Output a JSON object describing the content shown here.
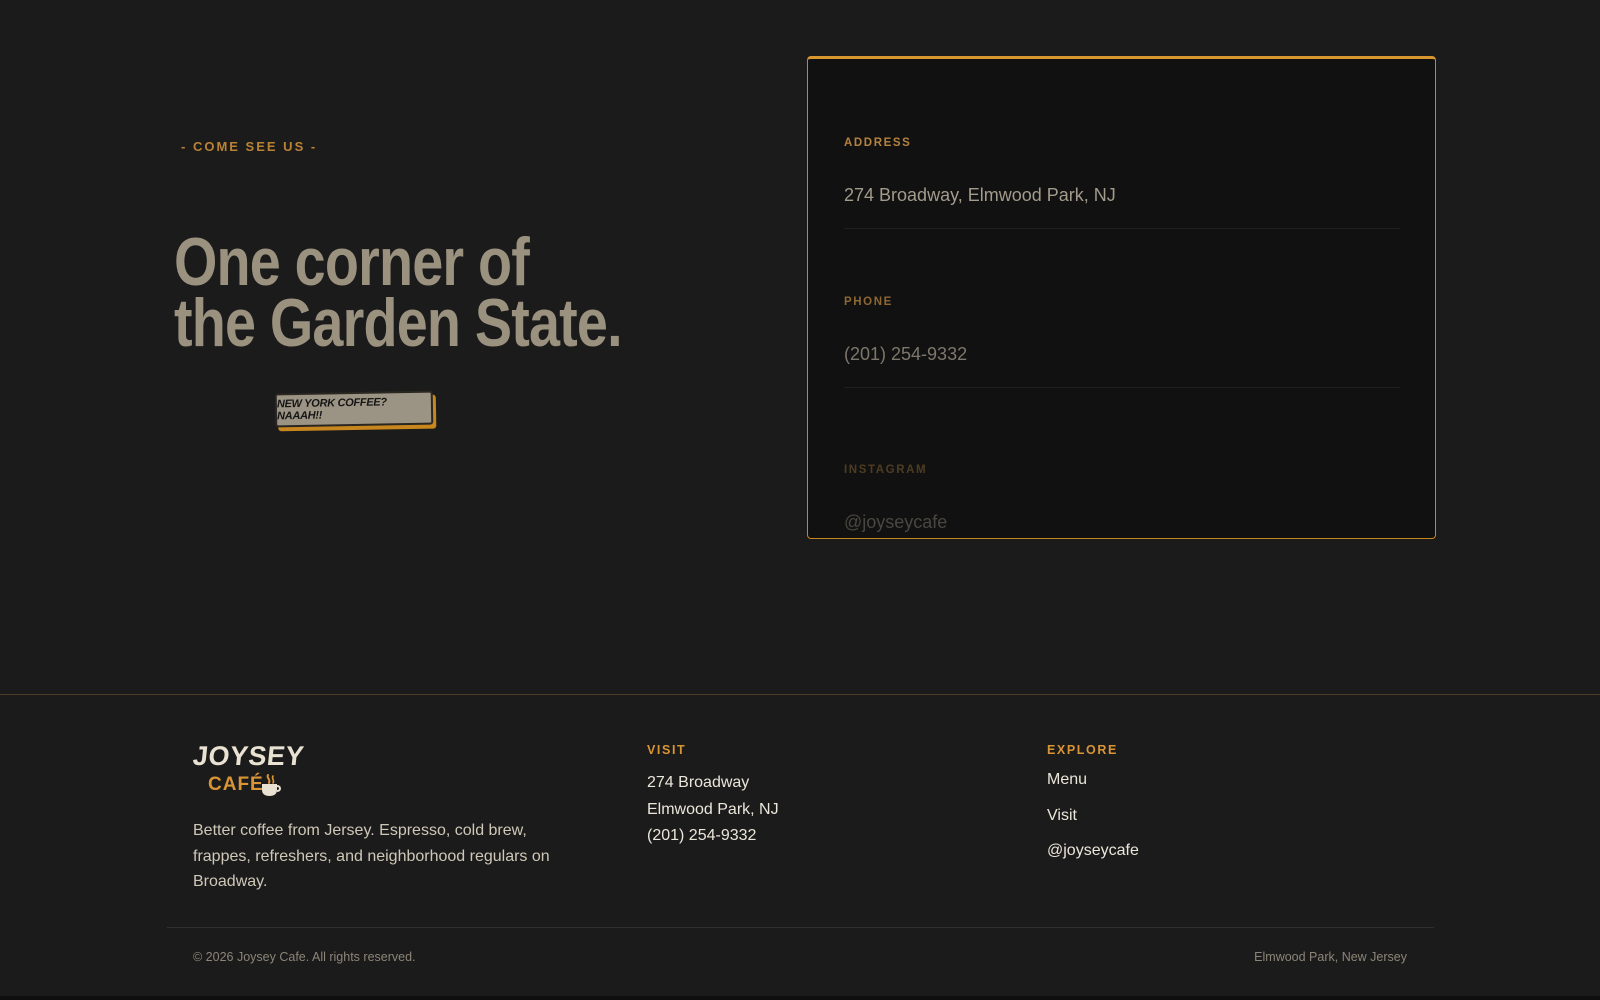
{
  "visit": {
    "eyebrow": "- COME SEE US -",
    "headline_line1": "One corner of",
    "headline_line2": "the Garden State.",
    "sticker": "NEW YORK COFFEE? NAAAH!!"
  },
  "info_card": {
    "address_label": "ADDRESS",
    "address_value": "274 Broadway, Elmwood Park, NJ",
    "phone_label": "PHONE",
    "phone_value": "(201) 254-9332",
    "instagram_label": "INSTAGRAM",
    "instagram_value": "@joyseycafe"
  },
  "footer": {
    "logo_top": "JOYSEY",
    "logo_bottom": "CAFÉ",
    "about": "Better coffee from Jersey. Espresso, cold brew, frappes, refreshers, and neighborhood regulars on Broadway.",
    "visit_heading": "VISIT",
    "visit_lines": [
      "274 Broadway",
      "Elmwood Park, NJ",
      "(201) 254-9332"
    ],
    "explore_heading": "EXPLORE",
    "explore_links": [
      "Menu",
      "Visit",
      "@joyseycafe"
    ],
    "copyright": "© 2026 Joysey Cafe. All rights reserved.",
    "location": "Elmwood Park, New Jersey"
  },
  "colors": {
    "accent": "#d99535",
    "background": "#1b1b1b",
    "card": "#111111",
    "headline": "#9a917f"
  },
  "icons": {
    "logo_cup": "coffee-cup-icon"
  }
}
